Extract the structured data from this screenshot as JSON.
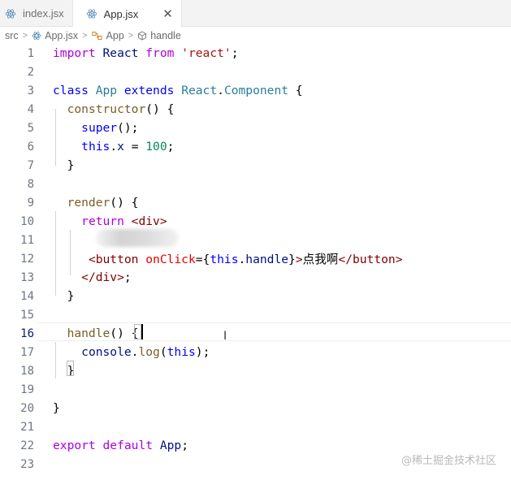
{
  "tabs": [
    {
      "label": "index.jsx",
      "active": false,
      "icon": "react-icon"
    },
    {
      "label": "App.jsx",
      "active": true,
      "icon": "react-icon",
      "close": "✕"
    }
  ],
  "breadcrumb": {
    "items": [
      "src",
      "App.jsx",
      "App",
      "handle"
    ],
    "sep": ">"
  },
  "editor": {
    "current_line": 16,
    "line_numbers": [
      "1",
      "2",
      "3",
      "4",
      "5",
      "6",
      "7",
      "8",
      "9",
      "10",
      "11",
      "12",
      "13",
      "14",
      "15",
      "16",
      "17",
      "18",
      "19",
      "20",
      "21",
      "22",
      "23"
    ],
    "lines": [
      [
        [
          "kw2",
          "import"
        ],
        [
          "txt",
          " "
        ],
        [
          "var",
          "React"
        ],
        [
          "txt",
          " "
        ],
        [
          "kw2",
          "from"
        ],
        [
          "txt",
          " "
        ],
        [
          "str",
          "'react'"
        ],
        [
          "txt",
          ";"
        ]
      ],
      [],
      [
        [
          "kw",
          "class"
        ],
        [
          "txt",
          " "
        ],
        [
          "cls",
          "App"
        ],
        [
          "txt",
          " "
        ],
        [
          "kw",
          "extends"
        ],
        [
          "txt",
          " "
        ],
        [
          "cls",
          "React"
        ],
        [
          "txt",
          "."
        ],
        [
          "cls",
          "Component"
        ],
        [
          "txt",
          " {"
        ]
      ],
      [
        [
          "txt",
          "  "
        ],
        [
          "fn",
          "constructor"
        ],
        [
          "txt",
          "() {"
        ]
      ],
      [
        [
          "txt",
          "    "
        ],
        [
          "kw",
          "super"
        ],
        [
          "txt",
          "();"
        ]
      ],
      [
        [
          "txt",
          "    "
        ],
        [
          "kw",
          "this"
        ],
        [
          "txt",
          "."
        ],
        [
          "var",
          "x"
        ],
        [
          "txt",
          " = "
        ],
        [
          "num",
          "100"
        ],
        [
          "txt",
          ";"
        ]
      ],
      [
        [
          "txt",
          "  }"
        ]
      ],
      [],
      [
        [
          "txt",
          "  "
        ],
        [
          "fn",
          "render"
        ],
        [
          "txt",
          "() {"
        ]
      ],
      [
        [
          "txt",
          "    "
        ],
        [
          "kw2",
          "return"
        ],
        [
          "txt",
          " "
        ],
        [
          "tag",
          "<div>"
        ]
      ],
      [],
      [
        [
          "txt",
          "     "
        ],
        [
          "tag",
          "<button"
        ],
        [
          "txt",
          " "
        ],
        [
          "attr",
          "onClick"
        ],
        [
          "txt",
          "={"
        ],
        [
          "kw",
          "this"
        ],
        [
          "txt",
          "."
        ],
        [
          "var",
          "handle"
        ],
        [
          "txt",
          "}"
        ],
        [
          "tag",
          ">"
        ],
        [
          "txt",
          "点我啊"
        ],
        [
          "tag",
          "</button>"
        ]
      ],
      [
        [
          "txt",
          "    "
        ],
        [
          "tag",
          "</div>"
        ],
        [
          "txt",
          ";"
        ]
      ],
      [
        [
          "txt",
          "  }"
        ]
      ],
      [],
      [
        [
          "txt",
          "  "
        ],
        [
          "fn",
          "handle"
        ],
        [
          "txt",
          "() {"
        ]
      ],
      [
        [
          "txt",
          "    "
        ],
        [
          "var",
          "console"
        ],
        [
          "txt",
          "."
        ],
        [
          "fn",
          "log"
        ],
        [
          "txt",
          "("
        ],
        [
          "kw",
          "this"
        ],
        [
          "txt",
          ");"
        ]
      ],
      [
        [
          "txt",
          "  }"
        ]
      ],
      [],
      [
        [
          "txt",
          "}"
        ]
      ],
      [],
      [
        [
          "kw2",
          "export"
        ],
        [
          "txt",
          " "
        ],
        [
          "kw2",
          "default"
        ],
        [
          "txt",
          " "
        ],
        [
          "var",
          "App"
        ],
        [
          "txt",
          ";"
        ]
      ],
      []
    ]
  },
  "watermark": "@稀土掘金技术社区",
  "colors": {
    "keyword": "#0000ff",
    "control_keyword": "#af00db",
    "class": "#267f99",
    "function": "#795e26",
    "variable": "#001080",
    "string": "#a31515",
    "number": "#098658",
    "tag": "#800000",
    "attribute": "#e50000"
  }
}
